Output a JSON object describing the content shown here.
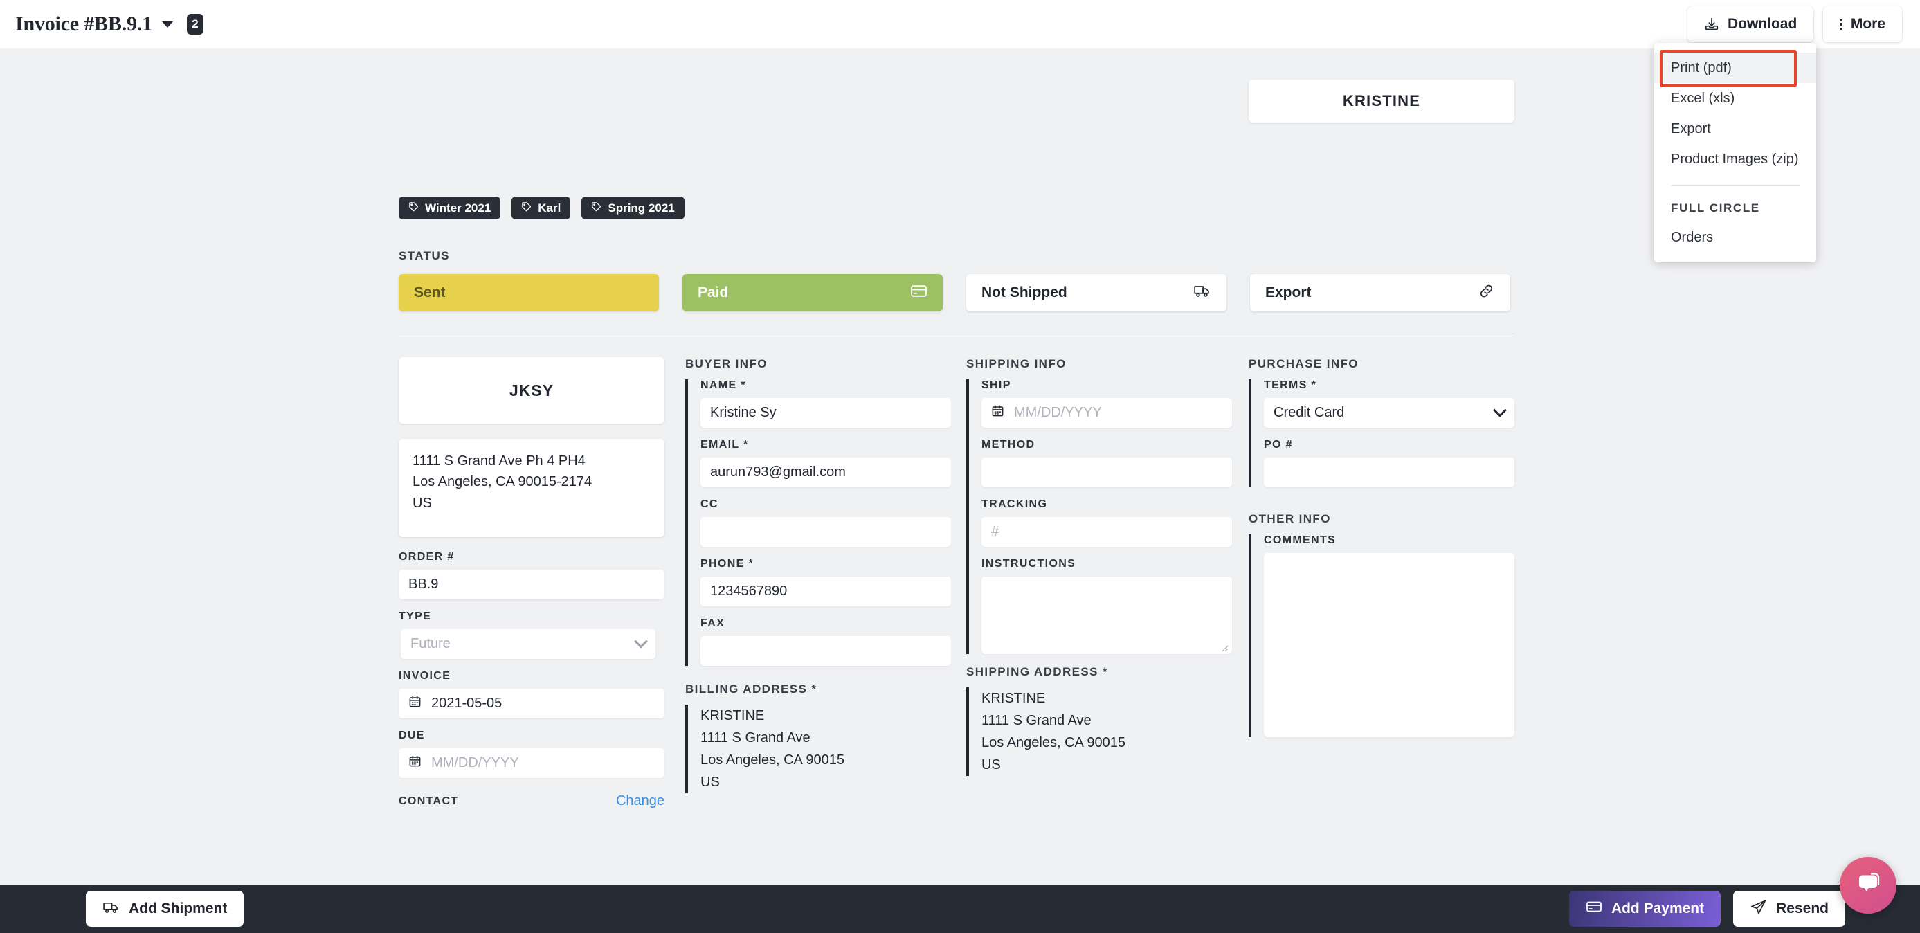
{
  "header": {
    "title": "Invoice #BB.9.1",
    "count_badge": "2",
    "download_label": "Download",
    "more_label": "More"
  },
  "menu": {
    "items": [
      {
        "label": "Print (pdf)",
        "highlighted": true
      },
      {
        "label": "Excel (xls)",
        "highlighted": false
      },
      {
        "label": "Export",
        "highlighted": false
      },
      {
        "label": "Product Images (zip)",
        "highlighted": false
      }
    ],
    "section_label": "FULL CIRCLE",
    "section_items": [
      {
        "label": "Orders"
      }
    ],
    "highlight_color": "#e8462a"
  },
  "company_card": {
    "name": "KRISTINE"
  },
  "tags": [
    {
      "label": "Winter 2021"
    },
    {
      "label": "Karl"
    },
    {
      "label": "Spring 2021"
    }
  ],
  "status": {
    "label": "STATUS",
    "cards": [
      {
        "label": "Sent",
        "icon": "none",
        "color": "#e7d14c"
      },
      {
        "label": "Paid",
        "icon": "credit-card",
        "color": "#9cc162"
      },
      {
        "label": "Not Shipped",
        "icon": "truck",
        "color": "#ffffff"
      },
      {
        "label": "Export",
        "icon": "link",
        "color": "#ffffff"
      }
    ]
  },
  "order_column": {
    "logo_text": "JKSY",
    "address_lines": [
      "1111 S Grand Ave Ph 4 PH4",
      "Los Angeles, CA 90015-2174",
      "US"
    ],
    "order_number_label": "ORDER #",
    "order_number_value": "BB.9",
    "type_label": "TYPE",
    "type_value": "Future",
    "invoice_label": "INVOICE",
    "invoice_value": "2021-05-05",
    "due_label": "DUE",
    "due_placeholder": "MM/DD/YYYY",
    "contact_label": "CONTACT",
    "contact_change_label": "Change"
  },
  "buyer_info": {
    "heading": "BUYER INFO",
    "fields": [
      {
        "label": "NAME *",
        "value": "Kristine Sy",
        "placeholder": ""
      },
      {
        "label": "EMAIL *",
        "value": "aurun793@gmail.com",
        "placeholder": ""
      },
      {
        "label": "CC",
        "value": "",
        "placeholder": ""
      },
      {
        "label": "PHONE *",
        "value": "1234567890",
        "placeholder": ""
      },
      {
        "label": "FAX",
        "value": "",
        "placeholder": ""
      }
    ],
    "billing_heading": "BILLING ADDRESS *",
    "billing_lines": [
      "KRISTINE",
      "1111 S Grand Ave",
      "Los Angeles, CA 90015",
      "US"
    ]
  },
  "shipping_info": {
    "heading": "SHIPPING INFO",
    "ship_label": "SHIP",
    "ship_placeholder": "MM/DD/YYYY",
    "method_label": "METHOD",
    "method_value": "",
    "tracking_label": "TRACKING",
    "tracking_placeholder": "#",
    "instructions_label": "INSTRUCTIONS",
    "instructions_value": "",
    "shipping_heading": "SHIPPING ADDRESS *",
    "shipping_lines": [
      "KRISTINE",
      "1111 S Grand Ave",
      "Los Angeles, CA 90015",
      "US"
    ]
  },
  "purchase_info": {
    "heading": "PURCHASE INFO",
    "terms_label": "TERMS *",
    "terms_value": "Credit Card",
    "po_label": "PO #",
    "po_value": "",
    "other_heading": "OTHER INFO",
    "comments_label": "COMMENTS",
    "comments_value": ""
  },
  "footer": {
    "add_shipment_label": "Add Shipment",
    "add_payment_label": "Add Payment",
    "resend_label": "Resend"
  }
}
